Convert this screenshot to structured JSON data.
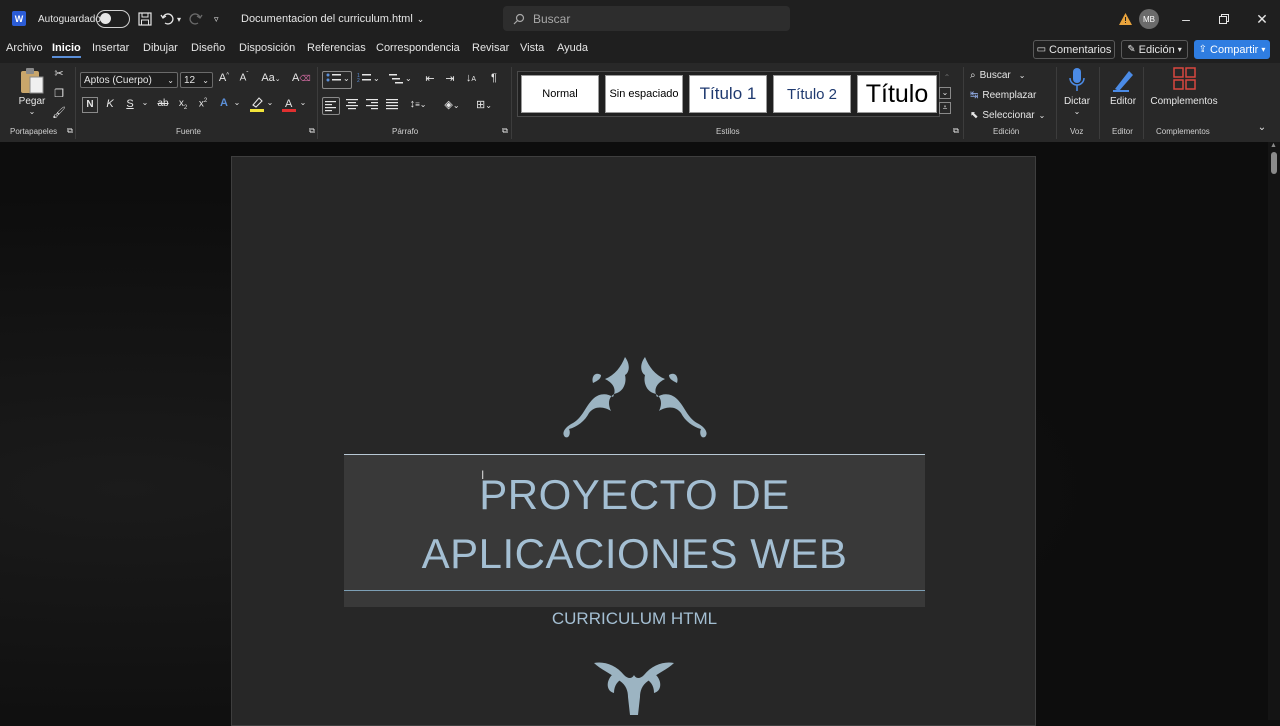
{
  "titlebar": {
    "autosave_label": "Autoguardado",
    "doc_title": "Documentacion del curriculum.html",
    "search_placeholder": "Buscar",
    "avatar_initials": "MB"
  },
  "menu": {
    "tabs": [
      "Archivo",
      "Inicio",
      "Insertar",
      "Dibujar",
      "Diseño",
      "Disposición",
      "Referencias",
      "Correspondencia",
      "Revisar",
      "Vista",
      "Ayuda"
    ],
    "active": "Inicio",
    "comments_label": "Comentarios",
    "edit_label": "Edición",
    "share_label": "Compartir"
  },
  "ribbon": {
    "paste_label": "Pegar",
    "font_name": "Aptos (Cuerpo)",
    "font_size": "12",
    "styles": [
      "Normal",
      "Sin espaciado",
      "Título 1",
      "Título 2",
      "Título"
    ],
    "find_label": "Buscar",
    "replace_label": "Reemplazar",
    "select_label": "Seleccionar",
    "dictate_label": "Dictar",
    "editor_label": "Editor",
    "addins_label": "Complementos",
    "groups": {
      "clipboard": "Portapapeles",
      "font": "Fuente",
      "paragraph": "Párrafo",
      "styles": "Estilos",
      "editing": "Edición",
      "voice": "Voz",
      "editor": "Editor",
      "addins": "Complementos"
    }
  },
  "document": {
    "title_line1": "PROYECTO DE",
    "title_line2": "APLICACIONES WEB",
    "subtitle": "CURRICULUM HTML"
  },
  "colors": {
    "accent": "#a4bfd3",
    "share": "#2f7de1"
  }
}
